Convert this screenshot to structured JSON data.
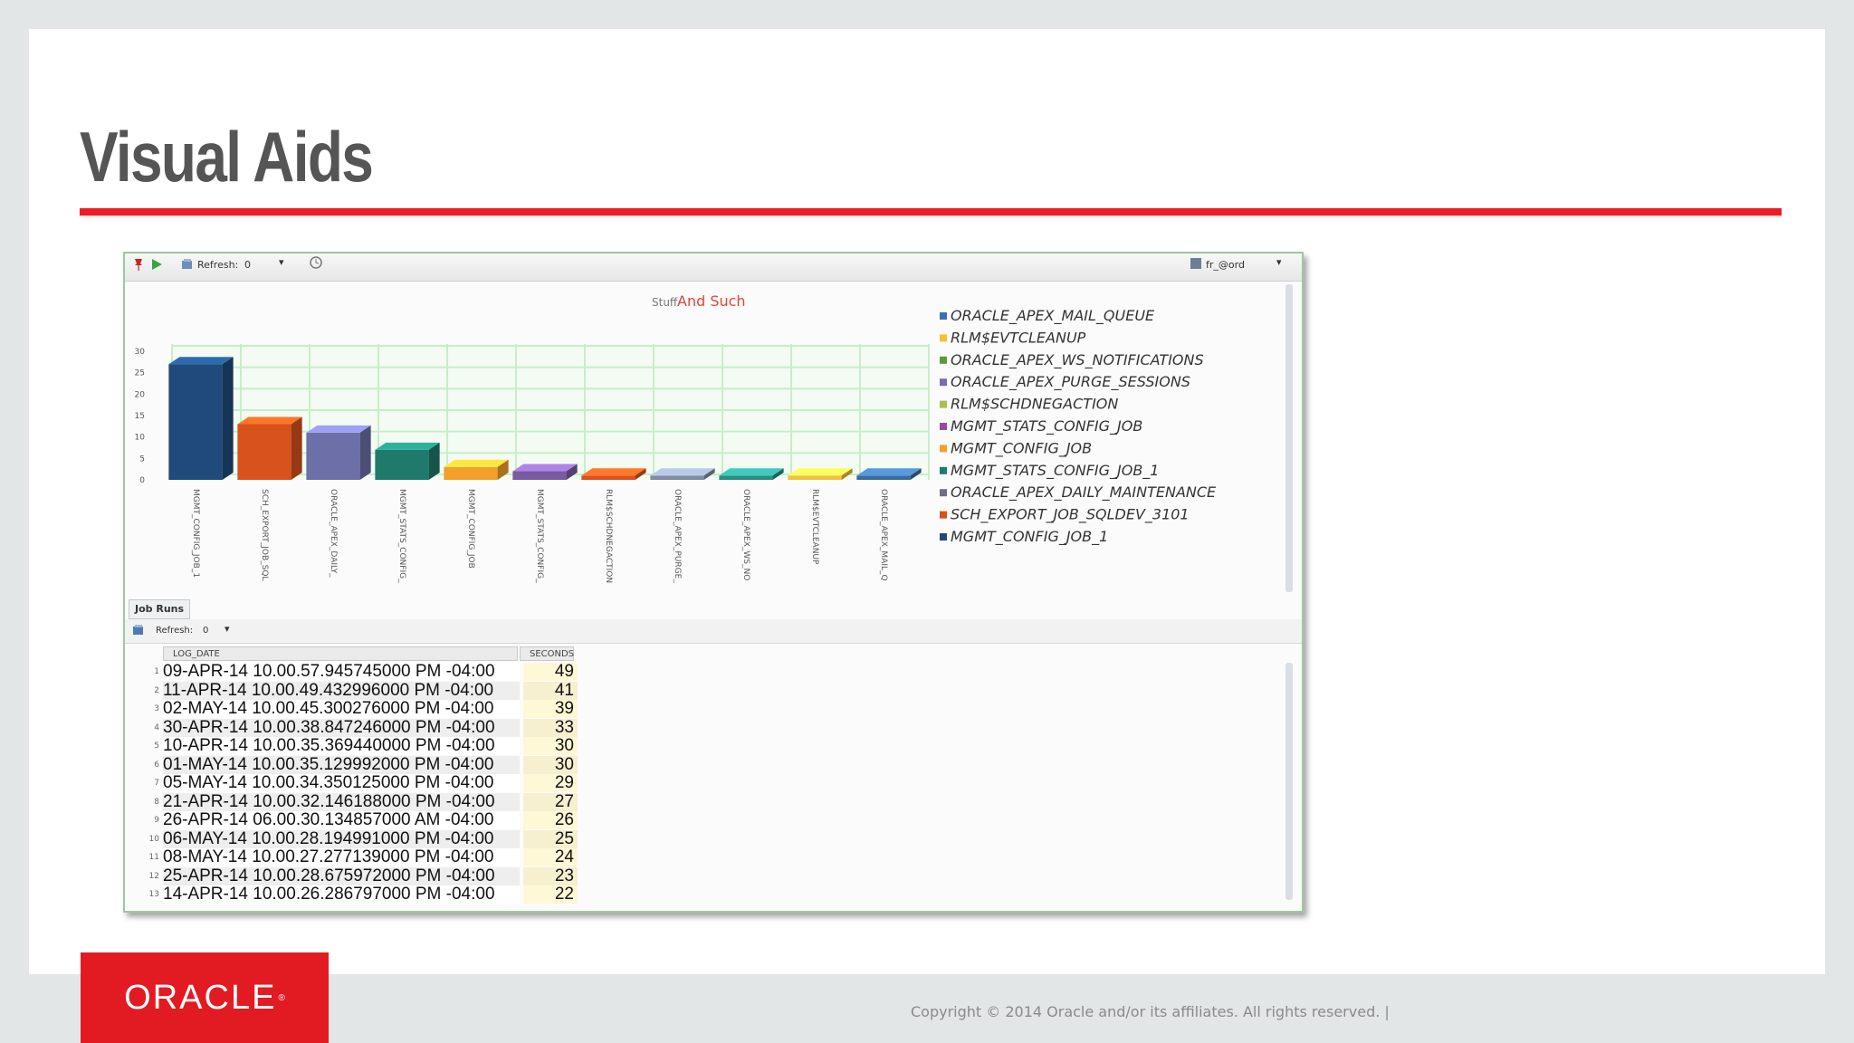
{
  "slide": {
    "title": "Visual Aids",
    "logo_text": "ORACLE",
    "copyright": "Copyright © 2014 Oracle and/or its affiliates. All rights reserved.  |"
  },
  "colors": {
    "accent_red": "#ee1c25",
    "logo_red": "#e21b23",
    "title_gray": "#555555"
  },
  "toolbar": {
    "pin_icon": "pin-icon",
    "run_icon": "play-icon",
    "refresh_label": "Refresh:",
    "refresh_value": "0",
    "right_label": "fr_@ord"
  },
  "chart_data": {
    "type": "bar",
    "title_prefix": "Stuff",
    "title": "And Such",
    "yticks": [
      "0",
      "5",
      "10",
      "15",
      "20",
      "25",
      "30"
    ],
    "ylim": [
      0,
      30
    ],
    "categories": [
      "MGMT_CONFIG_JOB_1",
      "SCH_EXPORT_JOB_SQL",
      "ORACLE_APEX_DAILY_",
      "MGMT_STATS_CONFIG_",
      "MGMT_CONFIG_JOB",
      "MGMT_STATS_CONFIG_",
      "RLM$SCHDNEGACTION",
      "ORACLE_APEX_PURGE_",
      "ORACLE_APEX_WS_NO",
      "RLM$EVTCLEANUP",
      "ORACLE_APEX_MAIL_Q"
    ],
    "values": [
      27,
      13,
      11,
      7,
      3,
      2,
      1,
      1,
      1,
      1,
      1
    ],
    "bar_colors": [
      "#1f4a7a",
      "#d8521c",
      "#6d6fa8",
      "#1f7a6c",
      "#f2a02a",
      "#7a5aa0",
      "#d8521c",
      "#7e8ca0",
      "#2b8c82",
      "#f2c040",
      "#3b6b9a"
    ],
    "legend": [
      {
        "name": "ORACLE_APEX_MAIL_QUEUE",
        "color": "#3b6fb0"
      },
      {
        "name": "RLM$EVTCLEANUP",
        "color": "#f2c230"
      },
      {
        "name": "ORACLE_APEX_WS_NOTIFICATIONS",
        "color": "#5c9a3a"
      },
      {
        "name": "ORACLE_APEX_PURGE_SESSIONS",
        "color": "#7b6bb0"
      },
      {
        "name": "RLM$SCHDNEGACTION",
        "color": "#a6c04a"
      },
      {
        "name": "MGMT_STATS_CONFIG_JOB",
        "color": "#9a4a9a"
      },
      {
        "name": "MGMT_CONFIG_JOB",
        "color": "#f2a02a"
      },
      {
        "name": "MGMT_STATS_CONFIG_JOB_1",
        "color": "#1f7a6c"
      },
      {
        "name": "ORACLE_APEX_DAILY_MAINTENANCE",
        "color": "#6d6f80"
      },
      {
        "name": "SCH_EXPORT_JOB_SQLDEV_3101",
        "color": "#d8521c"
      },
      {
        "name": "MGMT_CONFIG_JOB_1",
        "color": "#1f4a7a"
      }
    ],
    "grid": true,
    "legend_position": "right"
  },
  "panel2": {
    "tab_label": "Job Runs",
    "refresh_label": "Refresh:",
    "refresh_value": "0",
    "columns": [
      "LOG_DATE",
      "SECONDS"
    ],
    "rows": [
      {
        "n": "1",
        "log_date": "09-APR-14 10.00.57.945745000 PM -04:00",
        "seconds": "49"
      },
      {
        "n": "2",
        "log_date": "11-APR-14 10.00.49.432996000 PM -04:00",
        "seconds": "41"
      },
      {
        "n": "3",
        "log_date": "02-MAY-14 10.00.45.300276000 PM -04:00",
        "seconds": "39"
      },
      {
        "n": "4",
        "log_date": "30-APR-14 10.00.38.847246000 PM -04:00",
        "seconds": "33"
      },
      {
        "n": "5",
        "log_date": "10-APR-14 10.00.35.369440000 PM -04:00",
        "seconds": "30"
      },
      {
        "n": "6",
        "log_date": "01-MAY-14 10.00.35.129992000 PM -04:00",
        "seconds": "30"
      },
      {
        "n": "7",
        "log_date": "05-MAY-14 10.00.34.350125000 PM -04:00",
        "seconds": "29"
      },
      {
        "n": "8",
        "log_date": "21-APR-14 10.00.32.146188000 PM -04:00",
        "seconds": "27"
      },
      {
        "n": "9",
        "log_date": "26-APR-14 06.00.30.134857000 AM -04:00",
        "seconds": "26"
      },
      {
        "n": "10",
        "log_date": "06-MAY-14 10.00.28.194991000 PM -04:00",
        "seconds": "25"
      },
      {
        "n": "11",
        "log_date": "08-MAY-14 10.00.27.277139000 PM -04:00",
        "seconds": "24"
      },
      {
        "n": "12",
        "log_date": "25-APR-14 10.00.28.675972000 PM -04:00",
        "seconds": "23"
      },
      {
        "n": "13",
        "log_date": "14-APR-14 10.00.26.286797000 PM -04:00",
        "seconds": "22"
      }
    ]
  }
}
